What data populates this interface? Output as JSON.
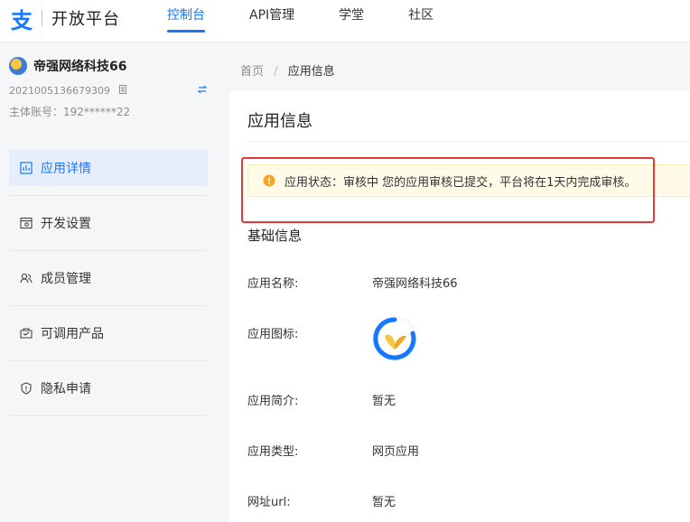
{
  "header": {
    "logo_char": "支",
    "logo_text": "开放平台",
    "nav": [
      "控制台",
      "API管理",
      "学堂",
      "社区"
    ]
  },
  "sidebar": {
    "account_name": "帝强网络科技66",
    "account_id": "2021005136679309",
    "main_account": "主体账号：192******22",
    "items": [
      {
        "label": "应用详情",
        "icon": "chart-icon"
      },
      {
        "label": "开发设置",
        "icon": "dev-settings-icon"
      },
      {
        "label": "成员管理",
        "icon": "members-icon"
      },
      {
        "label": "可调用产品",
        "icon": "products-icon"
      },
      {
        "label": "隐私申请",
        "icon": "privacy-shield-icon"
      }
    ]
  },
  "breadcrumb": {
    "home": "首页",
    "separator": "/",
    "current": "应用信息"
  },
  "main": {
    "title": "应用信息",
    "alert": "应用状态：审核中 您的应用审核已提交，平台将在1天内完成审核。",
    "section_title": "基础信息",
    "fields": [
      {
        "label": "应用名称:",
        "value": "帝强网络科技66"
      },
      {
        "label": "应用图标:",
        "value": ""
      },
      {
        "label": "应用简介:",
        "value": "暂无"
      },
      {
        "label": "应用类型:",
        "value": "网页应用"
      },
      {
        "label": "网址url:",
        "value": "暂无"
      }
    ]
  },
  "colors": {
    "accent": "#1677ff",
    "warning": "#f5a623",
    "highlight": "#e53935"
  }
}
